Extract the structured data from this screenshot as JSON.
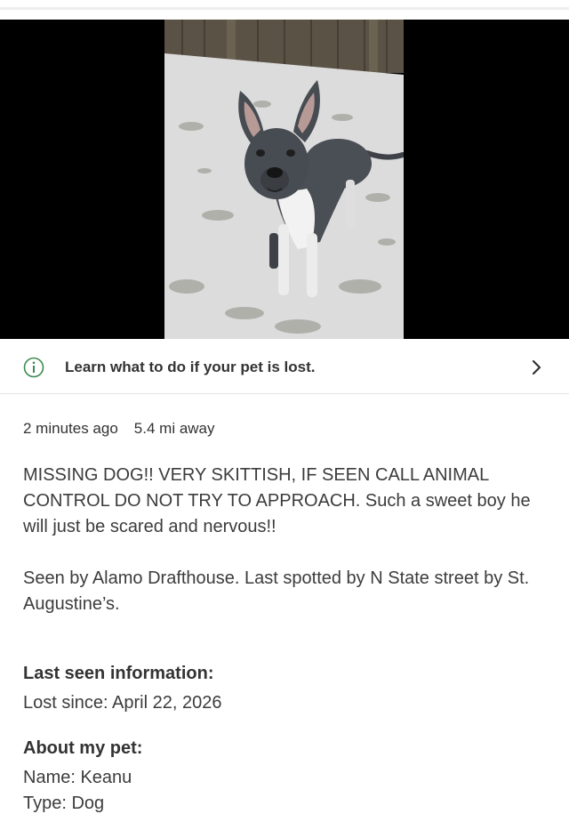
{
  "banner": {
    "text": "Learn what to do if your pet is lost."
  },
  "meta": {
    "time_ago": "2 minutes ago",
    "distance": "5.4 mi away"
  },
  "description": {
    "paragraph1": "MISSING DOG!! VERY SKITTISH, IF SEEN CALL ANIMAL CONTROL DO NOT TRY TO APPROACH. Such a sweet boy he will just be scared and nervous!!",
    "paragraph2": "Seen by Alamo Drafthouse. Last spotted by N State street by St. Augustine’s."
  },
  "last_seen": {
    "heading": "Last seen information:",
    "lost_since": "Lost since: April 22, 2026"
  },
  "about": {
    "heading": "About my pet:",
    "name": "Name: Keanu",
    "type": "Type: Dog"
  },
  "icons": {
    "info": "info-icon",
    "chevron": "chevron-right-icon"
  },
  "colors": {
    "text": "#333333",
    "photo_background": "#000000",
    "divider": "#e3e3e3"
  }
}
